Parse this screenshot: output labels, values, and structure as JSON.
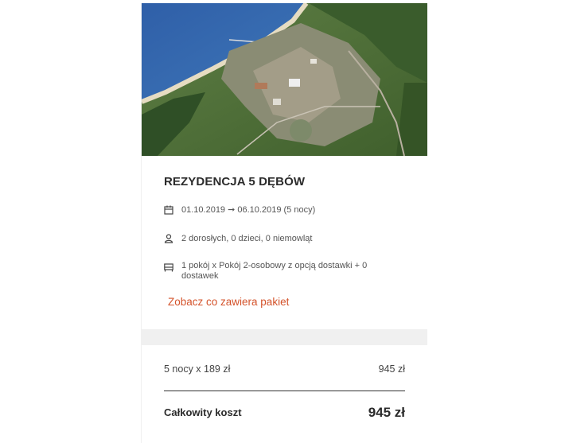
{
  "hotel": {
    "name": "REZYDENCJA 5 DĘBÓW",
    "photo_alt": "aerial-coastal-town-photo"
  },
  "stay": {
    "dates": "01.10.2019 ➞ 06.10.2019 (5 nocy)",
    "guests": "2 dorosłych, 0 dzieci, 0 niemowląt",
    "room": "1 pokój x Pokój 2-osobowy z opcją dostawki + 0 dostawek"
  },
  "package_link": "Zobacz co zawiera pakiet",
  "pricing": {
    "line_label": "5 nocy x 189 zł",
    "line_value": "945 zł",
    "total_label": "Całkowity koszt",
    "total_value": "945 zł"
  },
  "icons": {
    "dates": "calendar-icon",
    "guests": "person-icon",
    "room": "bed-icon"
  },
  "colors": {
    "accent": "#d4532b",
    "panel_background": "#f0f0f0",
    "text": "#333333"
  }
}
